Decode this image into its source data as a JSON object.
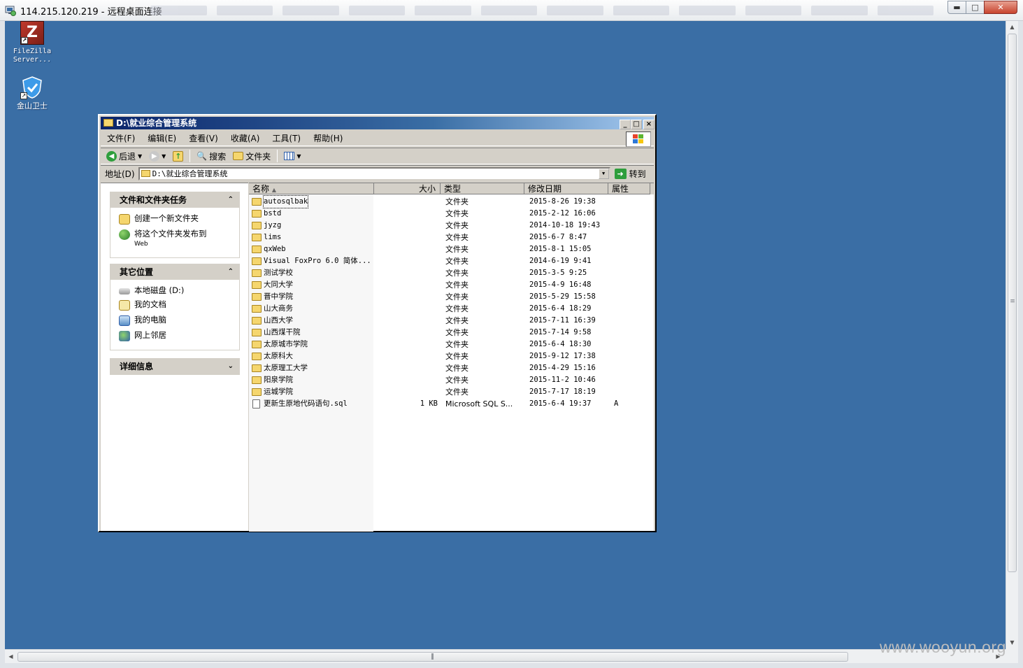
{
  "rdp": {
    "title": "114.215.120.219 - 远程桌面连接",
    "min": "▭",
    "max": "□",
    "close": "✕"
  },
  "desktop": {
    "icons": [
      {
        "label_line1": "FileZilla",
        "label_line2": "Server...",
        "icon": "filezilla-icon"
      },
      {
        "label_line1": "金山卫士",
        "label_line2": "",
        "icon": "shield-icon"
      }
    ],
    "watermark": "www.wooyun.org"
  },
  "explorer": {
    "title": "D:\\就业综合管理系统",
    "menu": [
      "文件(F)",
      "编辑(E)",
      "查看(V)",
      "收藏(A)",
      "工具(T)",
      "帮助(H)"
    ],
    "toolbar": {
      "back": "后退",
      "search": "搜索",
      "folders": "文件夹"
    },
    "address": {
      "label": "地址(D)",
      "value": "D:\\就业综合管理系统",
      "go": "转到"
    },
    "tasks": {
      "panel1_title": "文件和文件夹任务",
      "panel1_items": [
        "创建一个新文件夹",
        "将这个文件夹发布到",
        "Web"
      ],
      "panel2_title": "其它位置",
      "panel2_items": [
        "本地磁盘 (D:)",
        "我的文档",
        "我的电脑",
        "网上邻居"
      ],
      "panel3_title": "详细信息"
    },
    "columns": {
      "name": "名称",
      "size": "大小",
      "type": "类型",
      "date": "修改日期",
      "attr": "属性"
    },
    "files": [
      {
        "name": "autosqlbak",
        "size": "",
        "type": "文件夹",
        "date": "2015-8-26 19:38",
        "attr": ""
      },
      {
        "name": "bstd",
        "size": "",
        "type": "文件夹",
        "date": "2015-2-12 16:06",
        "attr": ""
      },
      {
        "name": "jyzg",
        "size": "",
        "type": "文件夹",
        "date": "2014-10-18 19:43",
        "attr": ""
      },
      {
        "name": "lims",
        "size": "",
        "type": "文件夹",
        "date": "2015-6-7 8:47",
        "attr": ""
      },
      {
        "name": "qxWeb",
        "size": "",
        "type": "文件夹",
        "date": "2015-8-1 15:05",
        "attr": ""
      },
      {
        "name": "Visual FoxPro 6.0 简体...",
        "size": "",
        "type": "文件夹",
        "date": "2014-6-19 9:41",
        "attr": ""
      },
      {
        "name": "测试学校",
        "size": "",
        "type": "文件夹",
        "date": "2015-3-5 9:25",
        "attr": ""
      },
      {
        "name": "大同大学",
        "size": "",
        "type": "文件夹",
        "date": "2015-4-9 16:48",
        "attr": ""
      },
      {
        "name": "晋中学院",
        "size": "",
        "type": "文件夹",
        "date": "2015-5-29 15:58",
        "attr": ""
      },
      {
        "name": "山大商务",
        "size": "",
        "type": "文件夹",
        "date": "2015-6-4 18:29",
        "attr": ""
      },
      {
        "name": "山西大学",
        "size": "",
        "type": "文件夹",
        "date": "2015-7-11 16:39",
        "attr": ""
      },
      {
        "name": "山西煤干院",
        "size": "",
        "type": "文件夹",
        "date": "2015-7-14 9:58",
        "attr": ""
      },
      {
        "name": "太原城市学院",
        "size": "",
        "type": "文件夹",
        "date": "2015-6-4 18:30",
        "attr": ""
      },
      {
        "name": "太原科大",
        "size": "",
        "type": "文件夹",
        "date": "2015-9-12 17:38",
        "attr": ""
      },
      {
        "name": "太原理工大学",
        "size": "",
        "type": "文件夹",
        "date": "2015-4-29 15:16",
        "attr": ""
      },
      {
        "name": "阳泉学院",
        "size": "",
        "type": "文件夹",
        "date": "2015-11-2 10:46",
        "attr": ""
      },
      {
        "name": "运城学院",
        "size": "",
        "type": "文件夹",
        "date": "2015-7-17 18:19",
        "attr": ""
      },
      {
        "name": "更新生原地代码语句.sql",
        "size": "1 KB",
        "type": "Microsoft SQL S...",
        "date": "2015-6-4 19:37",
        "attr": "A"
      }
    ]
  },
  "colors": {
    "desktop": "#3a6ea5",
    "titlebar_start": "#0a246a",
    "folder": "#f5d66e"
  }
}
